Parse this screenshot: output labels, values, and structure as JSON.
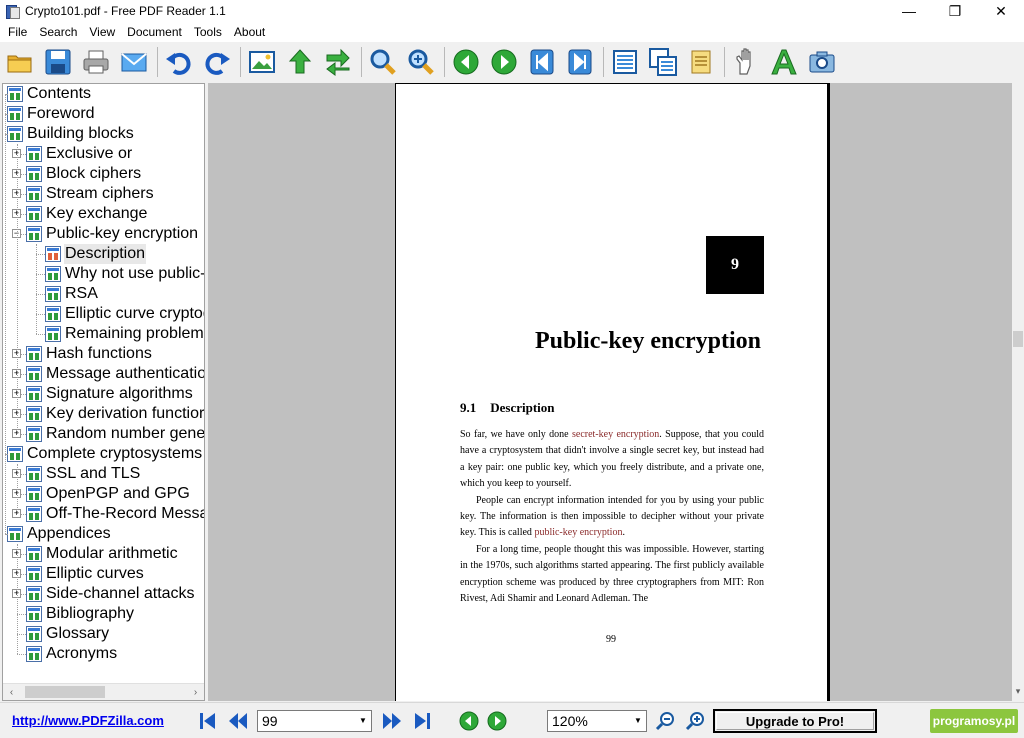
{
  "window": {
    "title": "Crypto101.pdf - Free PDF Reader 1.1",
    "controls": {
      "minimize": "—",
      "maximize": "❐",
      "close": "✕"
    }
  },
  "menu": [
    "File",
    "Search",
    "View",
    "Document",
    "Tools",
    "About"
  ],
  "toolbar": {
    "groups": [
      [
        "open-folder-icon",
        "save-icon",
        "print-icon",
        "email-icon"
      ],
      [
        "undo-icon",
        "redo-icon"
      ],
      [
        "image-icon",
        "up-arrow-icon",
        "swap-arrows-icon"
      ],
      [
        "zoom-in-icon",
        "zoom-fit-icon"
      ],
      [
        "previous-page-icon",
        "next-page-icon",
        "first-page-icon",
        "last-page-icon"
      ],
      [
        "single-page-icon",
        "multi-page-icon",
        "scroll-icon"
      ],
      [
        "hand-tool-icon",
        "text-tool-icon",
        "snapshot-icon"
      ]
    ]
  },
  "tree": {
    "items": [
      {
        "label": "Contents",
        "level": 0,
        "expander": ""
      },
      {
        "label": "Foreword",
        "level": 0,
        "expander": ""
      },
      {
        "label": "Building blocks",
        "level": 0,
        "expander": ""
      },
      {
        "label": "Exclusive or",
        "level": 1,
        "expander": "+"
      },
      {
        "label": "Block ciphers",
        "level": 1,
        "expander": "+"
      },
      {
        "label": "Stream ciphers",
        "level": 1,
        "expander": "+"
      },
      {
        "label": "Key exchange",
        "level": 1,
        "expander": "+"
      },
      {
        "label": "Public-key encryption",
        "level": 1,
        "expander": "−"
      },
      {
        "label": "Description",
        "level": 2,
        "expander": "",
        "selected": true
      },
      {
        "label": "Why not use public-",
        "level": 2,
        "expander": ""
      },
      {
        "label": "RSA",
        "level": 2,
        "expander": ""
      },
      {
        "label": "Elliptic curve cryptog",
        "level": 2,
        "expander": ""
      },
      {
        "label": "Remaining problem",
        "level": 2,
        "expander": ""
      },
      {
        "label": "Hash functions",
        "level": 1,
        "expander": "+"
      },
      {
        "label": "Message authenticatio",
        "level": 1,
        "expander": "+"
      },
      {
        "label": "Signature algorithms",
        "level": 1,
        "expander": "+"
      },
      {
        "label": "Key derivation functior",
        "level": 1,
        "expander": "+"
      },
      {
        "label": "Random number gene",
        "level": 1,
        "expander": "+"
      },
      {
        "label": "Complete cryptosystems",
        "level": 0,
        "expander": ""
      },
      {
        "label": "SSL and TLS",
        "level": 1,
        "expander": "+"
      },
      {
        "label": "OpenPGP and GPG",
        "level": 1,
        "expander": "+"
      },
      {
        "label": "Off-The-Record Messa",
        "level": 1,
        "expander": "+"
      },
      {
        "label": "Appendices",
        "level": 0,
        "expander": ""
      },
      {
        "label": "Modular arithmetic",
        "level": 1,
        "expander": "+"
      },
      {
        "label": "Elliptic curves",
        "level": 1,
        "expander": "+"
      },
      {
        "label": "Side-channel attacks",
        "level": 1,
        "expander": "+"
      },
      {
        "label": "Bibliography",
        "level": 1,
        "expander": ""
      },
      {
        "label": "Glossary",
        "level": 1,
        "expander": ""
      },
      {
        "label": "Acronyms",
        "level": 1,
        "expander": ""
      }
    ],
    "scroll_left": "‹",
    "scroll_right": "›"
  },
  "document": {
    "chapter_number": "9",
    "chapter_title": "Public-key encryption",
    "section_number": "9.1",
    "section_title": "Description",
    "paragraphs": [
      [
        {
          "text": "So far, we have only done "
        },
        {
          "text": "secret-key encryption",
          "link": true
        },
        {
          "text": ". Suppose, that you could have a cryptosystem that didn't involve a single secret key, but instead had a key pair: one public key, which you freely distribute, and a private one, which you keep to yourself."
        }
      ],
      [
        {
          "text": "People can encrypt information intended for you by using your public key. The information is then impossible to decipher without your private key. This is called "
        },
        {
          "text": "public-key encryption",
          "link": true
        },
        {
          "text": "."
        }
      ],
      [
        {
          "text": "For a long time, people thought this was impossible. However, starting in the 1970s, such algorithms started appearing. The first publicly available encryption scheme was produced by three cryptographers from MIT: Ron Rivest, Adi Shamir and Leonard Adleman. The"
        }
      ]
    ],
    "page_number": "99"
  },
  "statusbar": {
    "link_text": "http://www.PDFZilla.com",
    "page_value": "99",
    "zoom_value": "120%",
    "upgrade_label": "Upgrade to Pro!",
    "watermark": "programosy.pl"
  }
}
